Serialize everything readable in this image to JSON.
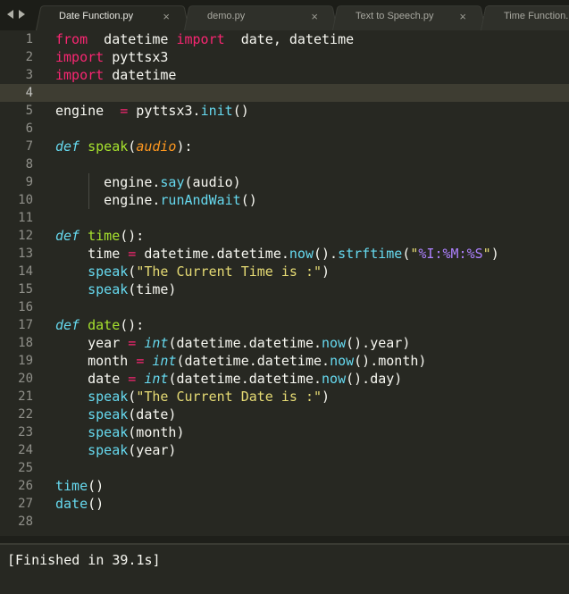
{
  "tabs": [
    {
      "label": "Date Function.py",
      "active": true,
      "close": "×"
    },
    {
      "label": "demo.py",
      "active": false,
      "close": "×"
    },
    {
      "label": "Text to Speech.py",
      "active": false,
      "close": "×"
    },
    {
      "label": "Time Function.py",
      "active": false,
      "close": ""
    }
  ],
  "editor": {
    "current_line": 4,
    "lines": [
      {
        "n": "1",
        "tokens": [
          [
            "kw",
            "from"
          ],
          [
            "",
            "  datetime "
          ],
          [
            "kw",
            "import"
          ],
          [
            "",
            "  date, datetime"
          ]
        ]
      },
      {
        "n": "2",
        "tokens": [
          [
            "kw",
            "import"
          ],
          [
            "",
            " pyttsx3"
          ]
        ]
      },
      {
        "n": "3",
        "tokens": [
          [
            "kw",
            "import"
          ],
          [
            "",
            " datetime"
          ]
        ]
      },
      {
        "n": "4",
        "tokens": []
      },
      {
        "n": "5",
        "tokens": [
          [
            "",
            "engine  "
          ],
          [
            "kw",
            "="
          ],
          [
            "",
            " pyttsx3."
          ],
          [
            "call",
            "init"
          ],
          [
            "",
            "()"
          ]
        ]
      },
      {
        "n": "6",
        "tokens": []
      },
      {
        "n": "7",
        "tokens": [
          [
            "def",
            "def"
          ],
          [
            "",
            " "
          ],
          [
            "fn",
            "speak"
          ],
          [
            "",
            "("
          ],
          [
            "arg",
            "audio"
          ],
          [
            "",
            "):"
          ]
        ]
      },
      {
        "n": "8",
        "tokens": []
      },
      {
        "n": "9",
        "tokens": [
          [
            "",
            "      engine."
          ],
          [
            "call",
            "say"
          ],
          [
            "",
            "(audio)"
          ]
        ]
      },
      {
        "n": "10",
        "tokens": [
          [
            "",
            "      engine."
          ],
          [
            "call",
            "runAndWait"
          ],
          [
            "",
            "()"
          ]
        ]
      },
      {
        "n": "11",
        "tokens": []
      },
      {
        "n": "12",
        "tokens": [
          [
            "def",
            "def"
          ],
          [
            "",
            " "
          ],
          [
            "fn",
            "time"
          ],
          [
            "",
            "():"
          ]
        ]
      },
      {
        "n": "13",
        "tokens": [
          [
            "",
            "    time "
          ],
          [
            "kw",
            "="
          ],
          [
            "",
            " datetime.datetime."
          ],
          [
            "call",
            "now"
          ],
          [
            "",
            "()."
          ],
          [
            "call",
            "strftime"
          ],
          [
            "",
            "("
          ],
          [
            "str",
            "\""
          ],
          [
            "fmt",
            "%I:%M:%S"
          ],
          [
            "str",
            "\""
          ],
          [
            "",
            ")"
          ]
        ]
      },
      {
        "n": "14",
        "tokens": [
          [
            "",
            "    "
          ],
          [
            "call",
            "speak"
          ],
          [
            "",
            "("
          ],
          [
            "str",
            "\"The Current Time is :\""
          ],
          [
            "",
            ")"
          ]
        ]
      },
      {
        "n": "15",
        "tokens": [
          [
            "",
            "    "
          ],
          [
            "call",
            "speak"
          ],
          [
            "",
            "(time)"
          ]
        ]
      },
      {
        "n": "16",
        "tokens": []
      },
      {
        "n": "17",
        "tokens": [
          [
            "def",
            "def"
          ],
          [
            "",
            " "
          ],
          [
            "fn",
            "date"
          ],
          [
            "",
            "():"
          ]
        ]
      },
      {
        "n": "18",
        "tokens": [
          [
            "",
            "    year "
          ],
          [
            "kw",
            "="
          ],
          [
            "",
            " "
          ],
          [
            "def",
            "int"
          ],
          [
            "",
            "(datetime.datetime."
          ],
          [
            "call",
            "now"
          ],
          [
            "",
            "().year)"
          ]
        ]
      },
      {
        "n": "19",
        "tokens": [
          [
            "",
            "    month "
          ],
          [
            "kw",
            "="
          ],
          [
            "",
            " "
          ],
          [
            "def",
            "int"
          ],
          [
            "",
            "(datetime.datetime."
          ],
          [
            "call",
            "now"
          ],
          [
            "",
            "().month)"
          ]
        ]
      },
      {
        "n": "20",
        "tokens": [
          [
            "",
            "    date "
          ],
          [
            "kw",
            "="
          ],
          [
            "",
            " "
          ],
          [
            "def",
            "int"
          ],
          [
            "",
            "(datetime.datetime."
          ],
          [
            "call",
            "now"
          ],
          [
            "",
            "().day)"
          ]
        ]
      },
      {
        "n": "21",
        "tokens": [
          [
            "",
            "    "
          ],
          [
            "call",
            "speak"
          ],
          [
            "",
            "("
          ],
          [
            "str",
            "\"The Current Date is :\""
          ],
          [
            "",
            ")"
          ]
        ]
      },
      {
        "n": "22",
        "tokens": [
          [
            "",
            "    "
          ],
          [
            "call",
            "speak"
          ],
          [
            "",
            "(date)"
          ]
        ]
      },
      {
        "n": "23",
        "tokens": [
          [
            "",
            "    "
          ],
          [
            "call",
            "speak"
          ],
          [
            "",
            "(month)"
          ]
        ]
      },
      {
        "n": "24",
        "tokens": [
          [
            "",
            "    "
          ],
          [
            "call",
            "speak"
          ],
          [
            "",
            "(year)"
          ]
        ]
      },
      {
        "n": "25",
        "tokens": []
      },
      {
        "n": "26",
        "tokens": [
          [
            "call",
            "time"
          ],
          [
            "",
            "()"
          ]
        ]
      },
      {
        "n": "27",
        "tokens": [
          [
            "call",
            "date"
          ],
          [
            "",
            "()"
          ]
        ]
      },
      {
        "n": "28",
        "tokens": []
      }
    ]
  },
  "console": {
    "output": "[Finished in 39.1s]"
  },
  "colors": {
    "background": "#272822",
    "keyword": "#f92672",
    "function": "#a6e22e",
    "string": "#e6db74",
    "builtin": "#66d9ef",
    "param": "#fd971f",
    "constant": "#ae81ff"
  }
}
